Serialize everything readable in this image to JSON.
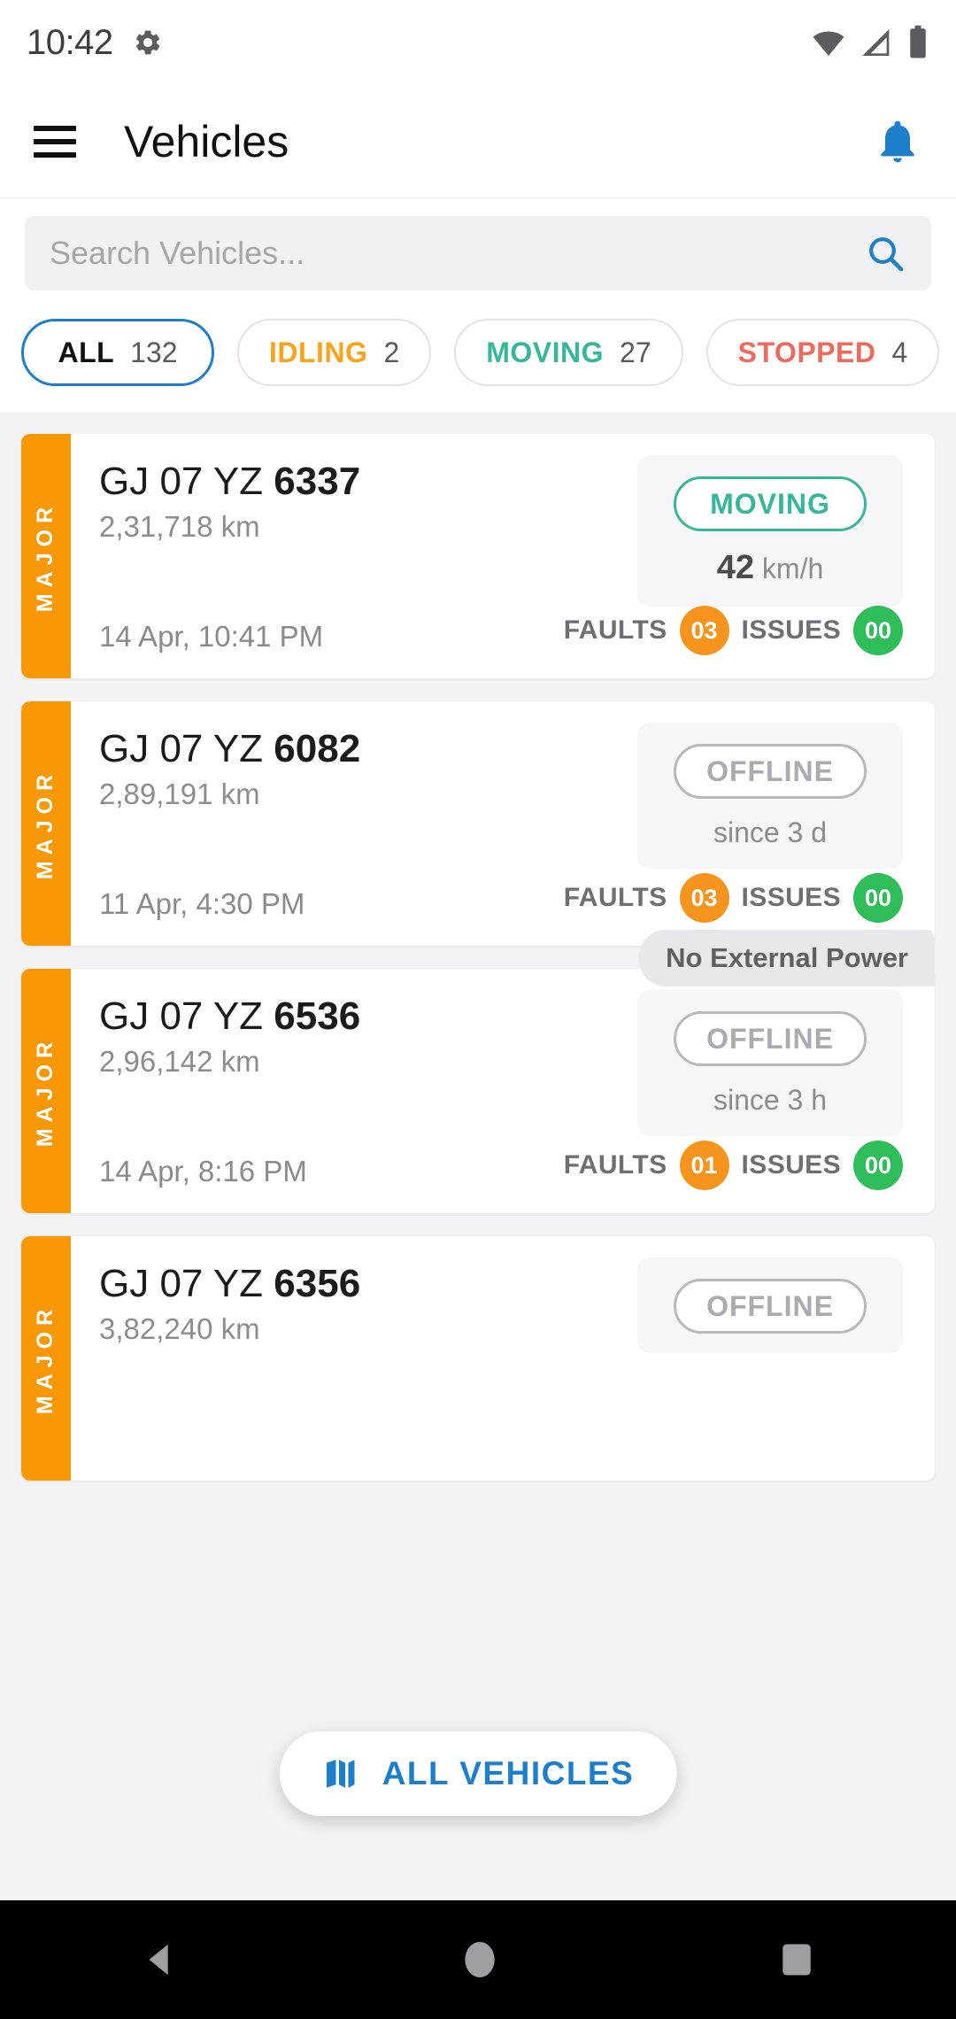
{
  "status_bar": {
    "time": "10:42",
    "icons": [
      "gear-icon",
      "wifi-icon",
      "cellular-signal-icon",
      "battery-icon"
    ]
  },
  "app_bar": {
    "menu_icon": "hamburger-menu-icon",
    "title": "Vehicles",
    "notification_icon": "bell-icon",
    "accent_color": "#1d7ec9"
  },
  "search": {
    "placeholder": "Search Vehicles...",
    "value": "",
    "icon": "search-icon"
  },
  "filters": [
    {
      "label": "ALL",
      "count": "132",
      "color": "#111111",
      "selected": true
    },
    {
      "label": "IDLING",
      "count": "2",
      "color": "#f9a21b",
      "selected": false
    },
    {
      "label": "MOVING",
      "count": "27",
      "color": "#36b79a",
      "selected": false
    },
    {
      "label": "STOPPED",
      "count": "4",
      "color": "#ef6a5e",
      "selected": false
    }
  ],
  "vehicles": [
    {
      "severity": "MAJOR",
      "severity_color": "#f99806",
      "plate_prefix": "GJ 07 YZ ",
      "plate_number": "6337",
      "odometer": "2,31,718 km",
      "status": "MOVING",
      "status_color": "#36b79a",
      "speed_value": "42",
      "speed_unit": "km/h",
      "timestamp": "14 Apr, 10:41 PM",
      "faults_label": "FAULTS",
      "faults_count": "03",
      "issues_label": "ISSUES",
      "issues_count": "00",
      "power_tag": ""
    },
    {
      "severity": "MAJOR",
      "severity_color": "#f99806",
      "plate_prefix": "GJ 07 YZ ",
      "plate_number": "6082",
      "odometer": "2,89,191 km",
      "status": "OFFLINE",
      "status_color": "#aaaab0",
      "since": "since 3 d",
      "timestamp": "11 Apr, 4:30 PM",
      "faults_label": "FAULTS",
      "faults_count": "03",
      "issues_label": "ISSUES",
      "issues_count": "00",
      "power_tag": ""
    },
    {
      "severity": "MAJOR",
      "severity_color": "#f99806",
      "plate_prefix": "GJ 07 YZ ",
      "plate_number": "6536",
      "odometer": "2,96,142 km",
      "status": "OFFLINE",
      "status_color": "#aaaab0",
      "since": "since 3 h",
      "timestamp": "14 Apr, 8:16 PM",
      "faults_label": "FAULTS",
      "faults_count": "01",
      "issues_label": "ISSUES",
      "issues_count": "00",
      "power_tag": "No External Power"
    },
    {
      "severity": "MAJOR",
      "severity_color": "#f99806",
      "plate_prefix": "GJ 07 YZ ",
      "plate_number": "6356",
      "odometer": "3,82,240 km",
      "status": "OFFLINE",
      "status_color": "#aaaab0",
      "since": "",
      "timestamp": "",
      "faults_label": "",
      "faults_count": "",
      "issues_label": "",
      "issues_count": "",
      "power_tag": ""
    }
  ],
  "fab": {
    "label": "ALL VEHICLES",
    "icon": "map-icon",
    "color": "#1d7ec9"
  },
  "nav_bar": {
    "back": "back-triangle-icon",
    "home": "home-circle-icon",
    "recents": "recents-square-icon"
  }
}
